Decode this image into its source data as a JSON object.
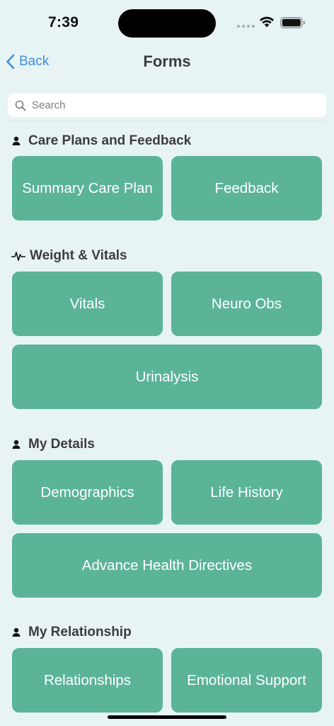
{
  "status_bar": {
    "time": "7:39"
  },
  "nav": {
    "back_label": "Back",
    "title": "Forms"
  },
  "search": {
    "placeholder": "Search",
    "value": ""
  },
  "sections": [
    {
      "title": "Care Plans and Feedback",
      "icon": "person-icon",
      "items": [
        "Summary Care Plan",
        "Feedback"
      ]
    },
    {
      "title": "Weight & Vitals",
      "icon": "heartbeat-icon",
      "items": [
        "Vitals",
        "Neuro Obs",
        "Urinalysis"
      ]
    },
    {
      "title": "My Details",
      "icon": "person-icon",
      "items": [
        "Demographics",
        "Life History",
        "Advance Health Directives"
      ]
    },
    {
      "title": "My Relationship",
      "icon": "person-icon",
      "items": [
        "Relationships",
        "Emotional Support"
      ]
    }
  ],
  "colors": {
    "background": "#e8f4f4",
    "tile": "#5bb498",
    "accent": "#3d8fe0"
  }
}
